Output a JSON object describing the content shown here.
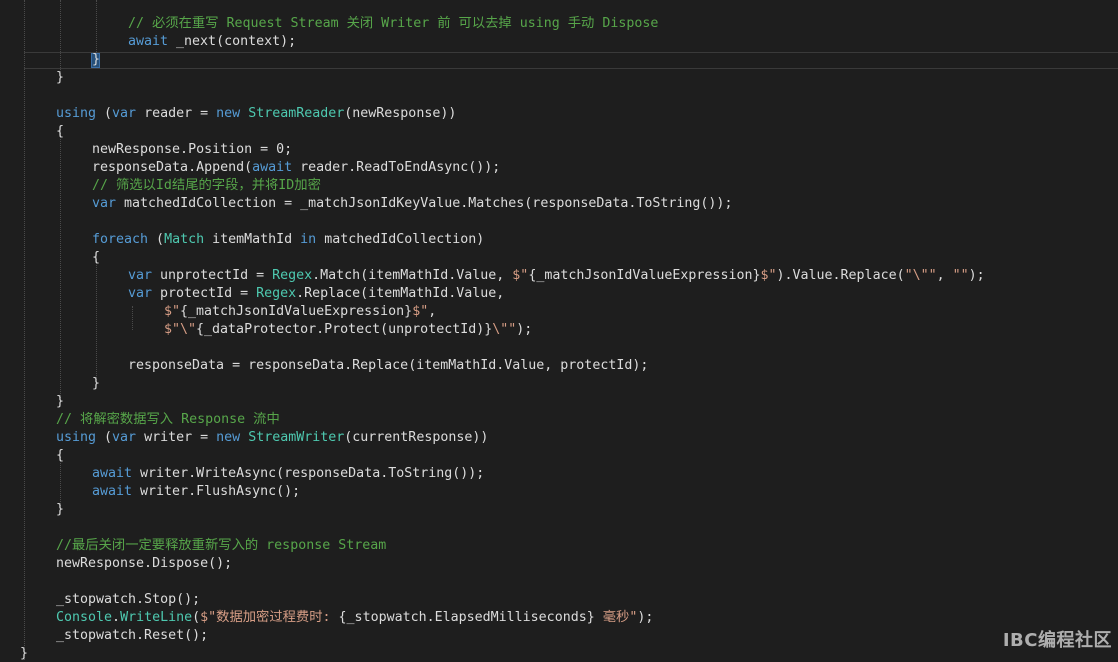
{
  "colors": {
    "background": "#1e1e1e",
    "plain": "#dcdcdc",
    "keyword": "#569cd6",
    "type": "#4ec9b0",
    "string": "#d69d85",
    "comment": "#57a64a"
  },
  "watermark": "IBC编程社区",
  "lines": [
    [
      [
        "cm",
        "// 必须在重写 Request Stream 关闭 Writer 前 可以去掉 using 手动 Dispose"
      ]
    ],
    [
      [
        "kw",
        "await"
      ],
      [
        "pl",
        " _next(context);"
      ]
    ],
    [
      [
        "pl",
        "}"
      ]
    ],
    [
      [
        "pl",
        "}"
      ]
    ],
    [],
    [
      [
        "kw",
        "using"
      ],
      [
        "pl",
        " ("
      ],
      [
        "kw",
        "var"
      ],
      [
        "pl",
        " reader = "
      ],
      [
        "kw",
        "new"
      ],
      [
        "pl",
        " "
      ],
      [
        "ty",
        "StreamReader"
      ],
      [
        "pl",
        "(newResponse))"
      ]
    ],
    [
      [
        "pl",
        "{"
      ]
    ],
    [
      [
        "pl",
        "newResponse.Position = 0;"
      ]
    ],
    [
      [
        "pl",
        "responseData.Append("
      ],
      [
        "kw",
        "await"
      ],
      [
        "pl",
        " reader.ReadToEndAsync());"
      ]
    ],
    [
      [
        "cm",
        "// 筛选以Id结尾的字段，并将ID加密"
      ]
    ],
    [
      [
        "kw",
        "var"
      ],
      [
        "pl",
        " matchedIdCollection = _matchJsonIdKeyValue.Matches(responseData.ToString());"
      ]
    ],
    [],
    [
      [
        "kw",
        "foreach"
      ],
      [
        "pl",
        " ("
      ],
      [
        "ty",
        "Match"
      ],
      [
        "pl",
        " itemMathId "
      ],
      [
        "kw",
        "in"
      ],
      [
        "pl",
        " matchedIdCollection)"
      ]
    ],
    [
      [
        "pl",
        "{"
      ]
    ],
    [
      [
        "kw",
        "var"
      ],
      [
        "pl",
        " unprotectId = "
      ],
      [
        "ty",
        "Regex"
      ],
      [
        "pl",
        ".Match(itemMathId.Value, "
      ],
      [
        "str",
        "$\""
      ],
      [
        "pl",
        "{_matchJsonIdValueExpression}"
      ],
      [
        "str",
        "$\""
      ],
      [
        "pl",
        ").Value.Replace("
      ],
      [
        "str",
        "\"\\\"\""
      ],
      [
        "pl",
        ", "
      ],
      [
        "str",
        "\"\""
      ],
      [
        "pl",
        ");"
      ]
    ],
    [
      [
        "kw",
        "var"
      ],
      [
        "pl",
        " protectId = "
      ],
      [
        "ty",
        "Regex"
      ],
      [
        "pl",
        ".Replace(itemMathId.Value,"
      ]
    ],
    [
      [
        "str",
        "$\""
      ],
      [
        "pl",
        "{_matchJsonIdValueExpression}"
      ],
      [
        "str",
        "$\""
      ],
      [
        "pl",
        ","
      ]
    ],
    [
      [
        "str",
        "$\"\\\""
      ],
      [
        "pl",
        "{_dataProtector.Protect(unprotectId)}"
      ],
      [
        "str",
        "\\\"\""
      ],
      [
        "pl",
        ");"
      ]
    ],
    [],
    [
      [
        "pl",
        "responseData = responseData.Replace(itemMathId.Value, protectId);"
      ]
    ],
    [
      [
        "pl",
        "}"
      ]
    ],
    [
      [
        "pl",
        "}"
      ]
    ],
    [
      [
        "cm",
        "// 将解密数据写入 Response 流中"
      ]
    ],
    [
      [
        "kw",
        "using"
      ],
      [
        "pl",
        " ("
      ],
      [
        "kw",
        "var"
      ],
      [
        "pl",
        " writer = "
      ],
      [
        "kw",
        "new"
      ],
      [
        "pl",
        " "
      ],
      [
        "ty",
        "StreamWriter"
      ],
      [
        "pl",
        "(currentResponse))"
      ]
    ],
    [
      [
        "pl",
        "{"
      ]
    ],
    [
      [
        "kw",
        "await"
      ],
      [
        "pl",
        " writer.WriteAsync(responseData.ToString());"
      ]
    ],
    [
      [
        "kw",
        "await"
      ],
      [
        "pl",
        " writer.FlushAsync();"
      ]
    ],
    [
      [
        "pl",
        "}"
      ]
    ],
    [],
    [
      [
        "cm",
        "//最后关闭一定要释放重新写入的 response Stream"
      ]
    ],
    [
      [
        "pl",
        "newResponse.Dispose();"
      ]
    ],
    [],
    [
      [
        "pl",
        "_stopwatch.Stop();"
      ]
    ],
    [
      [
        "ty",
        "Console"
      ],
      [
        "pl",
        "."
      ],
      [
        "ty",
        "WriteLine"
      ],
      [
        "pl",
        "("
      ],
      [
        "str",
        "$\"数据加密过程费时: "
      ],
      [
        "pl",
        "{_stopwatch.ElapsedMilliseconds}"
      ],
      [
        "str",
        " 毫秒\""
      ],
      [
        "pl",
        ");"
      ]
    ],
    [
      [
        "pl",
        "_stopwatch.Reset();"
      ]
    ],
    [
      [
        "pl",
        "}"
      ]
    ]
  ]
}
